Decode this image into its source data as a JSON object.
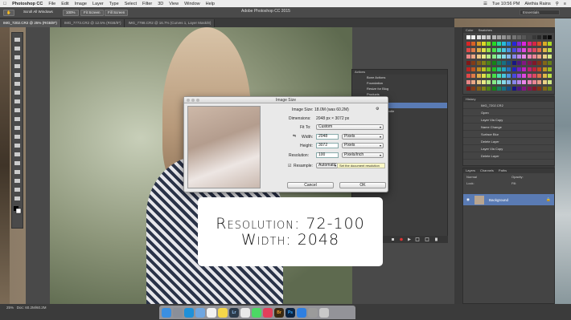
{
  "menubar": {
    "app_name": "Photoshop CC",
    "items": [
      "File",
      "Edit",
      "Image",
      "Layer",
      "Type",
      "Select",
      "Filter",
      "3D",
      "View",
      "Window",
      "Help"
    ],
    "clock": "Tue 10:56 PM",
    "user": "Alethia Rains"
  },
  "window_title": "Adobe Photoshop CC 2015",
  "options_bar": {
    "buttons": [
      "Scroll All Windows",
      "100%",
      "Fit Screen",
      "Fill Screen"
    ],
    "workspace": "Essentials"
  },
  "doc_tabs": [
    "IMG_7202.CR2 @ 25% (RGB/8*)",
    "IMG_7773.CR2 @ 12.5% (RGB/8*)",
    "IMG_7798.CR2 @ 16.7% (Curves 1, Layer Mask/8)"
  ],
  "dialog": {
    "title": "Image Size",
    "image_size_label": "Image Size:",
    "image_size_value": "18.0M (was 60.2M)",
    "dimensions_label": "Dimensions:",
    "dimensions_value": "2048 px × 3072 px",
    "fit_to_label": "Fit To:",
    "fit_to_value": "Custom",
    "width_label": "Width:",
    "width_value": "2048",
    "width_unit": "Pixels",
    "height_label": "Height:",
    "height_value": "3072",
    "height_unit": "Pixels",
    "resolution_label": "Resolution:",
    "resolution_value": "100",
    "resolution_unit": "Pixels/Inch",
    "resample_label": "Resample:",
    "resample_value": "Automatic",
    "tooltip": "Set the document resolution",
    "cancel": "Cancel",
    "ok": "OK"
  },
  "overlay": {
    "line1": "Resolution: 72-100",
    "line2": "Width: 2048"
  },
  "actions_panel": {
    "title": "Actions",
    "rows": [
      "Bone Actions",
      "Foundation",
      "Resize for Blog",
      "Products",
      "",
      "",
      "ation Action Bundle"
    ]
  },
  "history_panel": {
    "title": "History",
    "rows": [
      "IMG_7202.CR2",
      "Open",
      "Layer Via Copy",
      "Name Change",
      "Surface Blur",
      "Delete Layer",
      "Layer Via Copy",
      "Delete Layer"
    ]
  },
  "swatches_panel": {
    "tabs": [
      "Color",
      "Swatches"
    ]
  },
  "layers_panel": {
    "tabs": [
      "Layers",
      "Channels",
      "Paths"
    ],
    "blend_mode": "Normal",
    "opacity_label": "Opacity:",
    "lock_label": "Lock:",
    "fill_label": "Fill:",
    "layer_name": "Background"
  },
  "status": {
    "zoom": "25%",
    "doc": "Doc: 60.2M/60.2M"
  },
  "dock_icons": [
    "Finder",
    "Launchpad",
    "Safari",
    "Mail",
    "Calendar",
    "Notes",
    "Lr",
    "Photos",
    "Messages",
    "Music",
    "Br",
    "Ps",
    "App Store",
    "Prefs",
    "Trash"
  ]
}
